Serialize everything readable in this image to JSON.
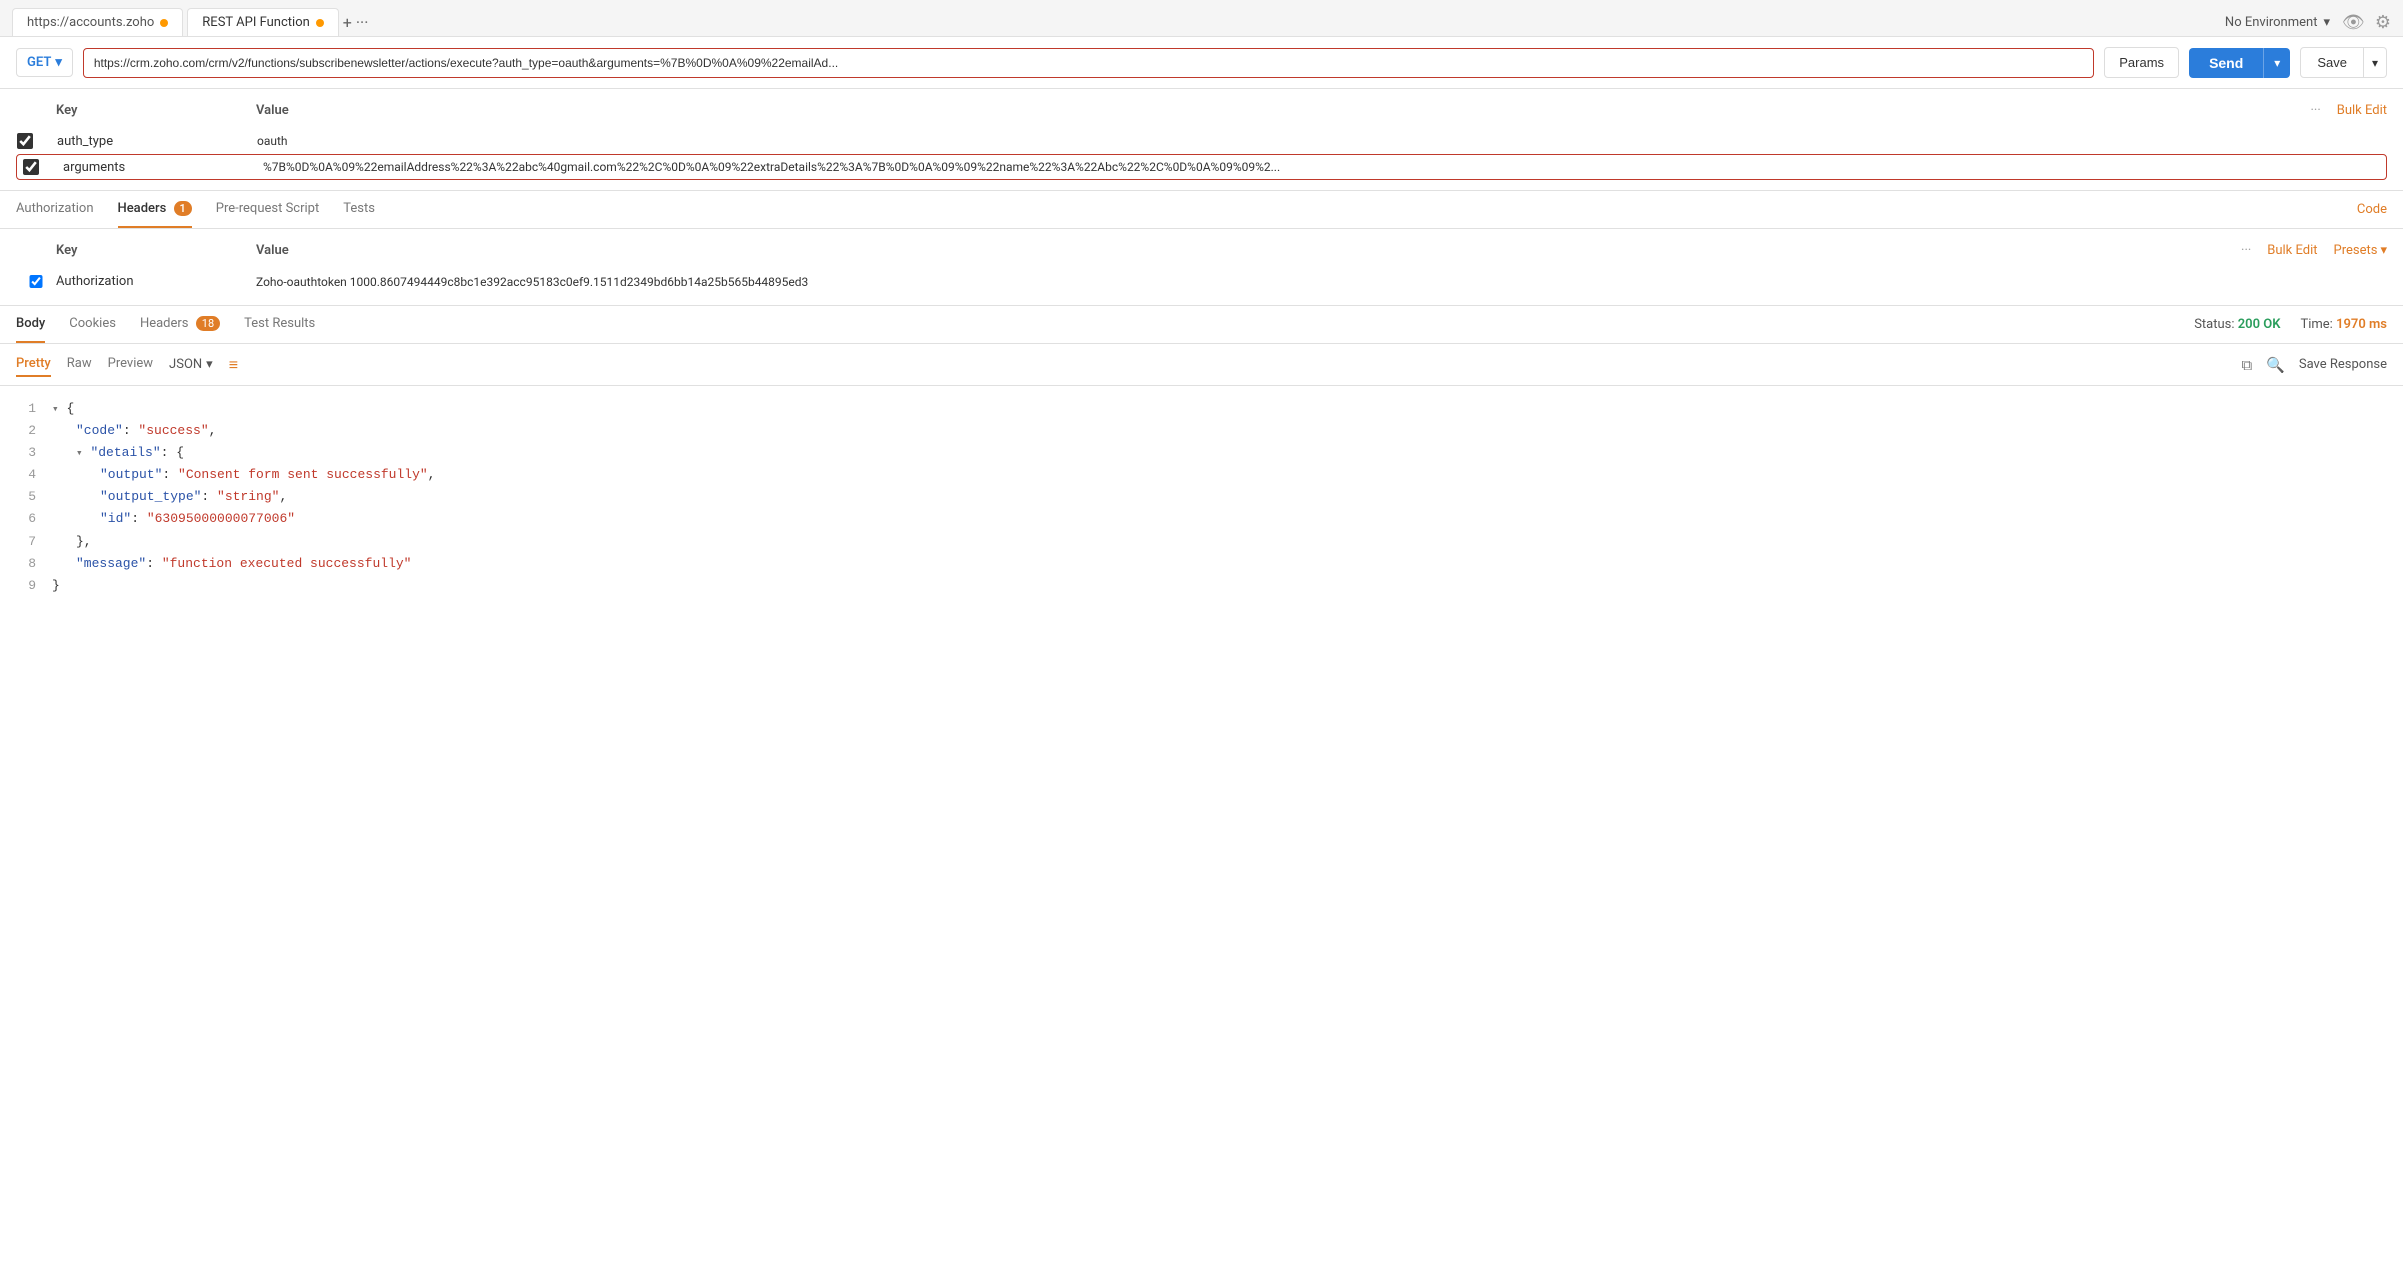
{
  "tabBar": {
    "tabs": [
      {
        "label": "https://accounts.zoho",
        "dotColor": "#f90",
        "id": "tab-accounts"
      },
      {
        "label": "REST API Function",
        "dotColor": "#f90",
        "id": "tab-rest"
      }
    ],
    "addLabel": "+",
    "moreLabel": "···",
    "envSelector": "No Environment",
    "envDropdown": "▾"
  },
  "urlBar": {
    "method": "GET",
    "url": "https://crm.zoho.com/crm/v2/functions/subscribenewsletter/actions/execute?auth_type=oauth&arguments=%7B%0D%0A%09%22emailAd...",
    "paramsLabel": "Params",
    "sendLabel": "Send",
    "saveLabel": "Save"
  },
  "paramsTable": {
    "columns": [
      "",
      "Key",
      "Value"
    ],
    "bulkEditLabel": "Bulk Edit",
    "rows": [
      {
        "checked": true,
        "key": "auth_type",
        "value": "oauth",
        "highlighted": false
      },
      {
        "checked": true,
        "key": "arguments",
        "value": "%7B%0D%0A%09%22emailAddress%22%3A%22abc%40gmail.com%22%2C%0D%0A%09%22extraDetails%22%3A%7B%0D%0A%09%09%22name%22%3A%22Abc%22%2C%0D%0A%09%09%2...",
        "highlighted": true
      }
    ]
  },
  "requestTabs": {
    "tabs": [
      {
        "label": "Authorization",
        "active": false,
        "badge": null
      },
      {
        "label": "Headers",
        "active": true,
        "badge": "1"
      },
      {
        "label": "Pre-request Script",
        "active": false,
        "badge": null
      },
      {
        "label": "Tests",
        "active": false,
        "badge": null
      }
    ],
    "codeLabel": "Code"
  },
  "headersTable": {
    "columns": [
      "",
      "Key",
      "Value"
    ],
    "bulkEditLabel": "Bulk Edit",
    "presetsLabel": "Presets",
    "rows": [
      {
        "checked": true,
        "key": "Authorization",
        "value": "Zoho-oauthtoken 1000.8607494449c8bc1e392acc95183c0ef9.1511d2349bd6bb14a25b565b44895ed3"
      }
    ]
  },
  "responseTabs": {
    "statusLabel": "Status:",
    "statusValue": "200 OK",
    "timeLabel": "Time:",
    "timeValue": "1970 ms",
    "tabs": [
      {
        "label": "Body",
        "active": true
      },
      {
        "label": "Cookies",
        "active": false
      },
      {
        "label": "Headers",
        "active": false,
        "badge": "18"
      },
      {
        "label": "Test Results",
        "active": false
      }
    ]
  },
  "responseToolbar": {
    "tabs": [
      {
        "label": "Pretty",
        "active": true
      },
      {
        "label": "Raw",
        "active": false
      },
      {
        "label": "Preview",
        "active": false
      }
    ],
    "format": "JSON",
    "saveResponseLabel": "Save Response"
  },
  "jsonResponse": {
    "lines": [
      {
        "num": 1,
        "content": "{",
        "type": "brace",
        "collapse": true
      },
      {
        "num": 2,
        "content": "\"code\": \"success\",",
        "indent": 1
      },
      {
        "num": 3,
        "content": "\"details\": {",
        "indent": 1,
        "collapse": true
      },
      {
        "num": 4,
        "content": "\"output\": \"Consent form sent successfully\",",
        "indent": 2
      },
      {
        "num": 5,
        "content": "\"output_type\": \"string\",",
        "indent": 2
      },
      {
        "num": 6,
        "content": "\"id\": \"63095000000077006\"",
        "indent": 2
      },
      {
        "num": 7,
        "content": "},",
        "indent": 1
      },
      {
        "num": 8,
        "content": "\"message\": \"function executed successfully\"",
        "indent": 1
      },
      {
        "num": 9,
        "content": "}",
        "type": "brace"
      }
    ]
  }
}
